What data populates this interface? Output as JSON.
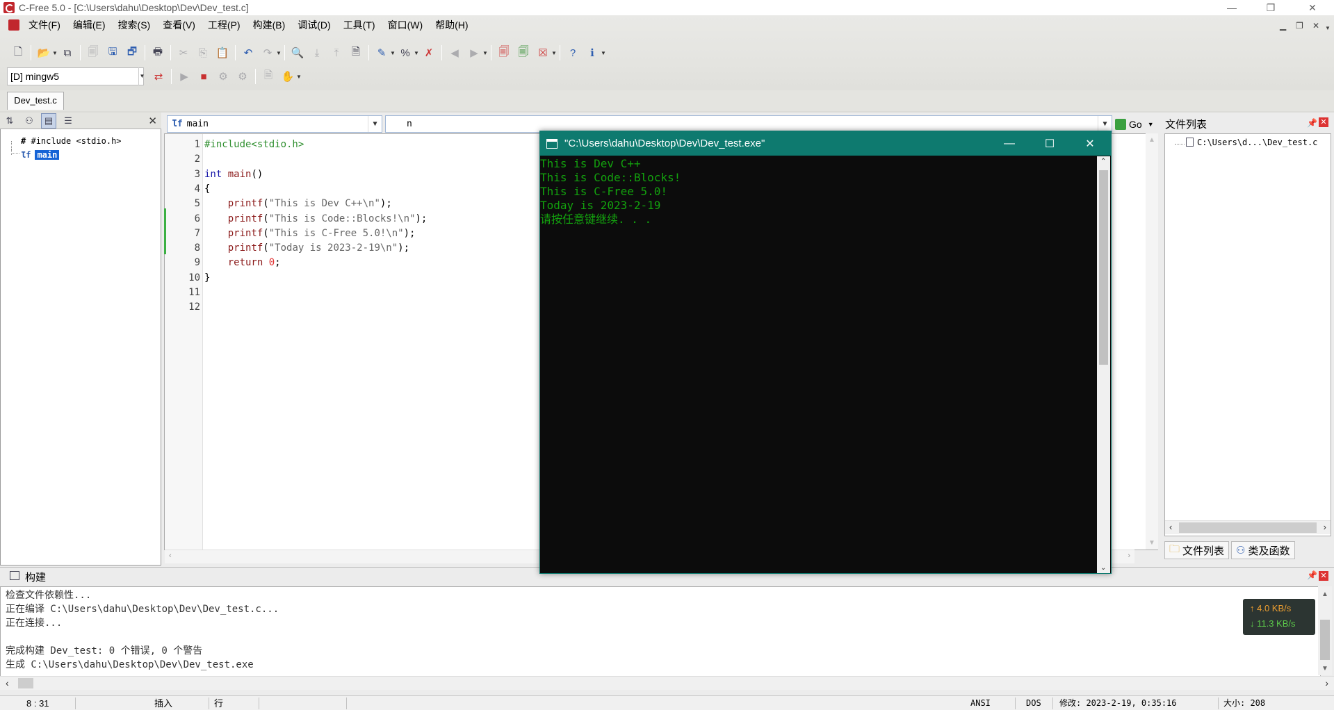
{
  "window": {
    "title": "C-Free 5.0 - [C:\\Users\\dahu\\Desktop\\Dev\\Dev_test.c]",
    "min": "—",
    "restore": "❐",
    "close": "✕"
  },
  "menu": [
    "文件(F)",
    "编辑(E)",
    "搜索(S)",
    "查看(V)",
    "工程(P)",
    "构建(B)",
    "调试(D)",
    "工具(T)",
    "窗口(W)",
    "帮助(H)"
  ],
  "compiler": {
    "value": "[D] mingw5"
  },
  "doc_tab": "Dev_test.c",
  "left_tree": {
    "include": "#include <stdio.h>",
    "func": "main"
  },
  "combo": {
    "scope": "main",
    "member": "n",
    "go": "Go"
  },
  "editor": {
    "line_numbers": [
      "1",
      "2",
      "3",
      "4",
      "5",
      "6",
      "7",
      "8",
      "9",
      "10",
      "11",
      "12"
    ],
    "lines": [
      [
        {
          "t": "#include<stdio.h>",
          "c": "pp"
        }
      ],
      [],
      [
        {
          "t": "int",
          "c": "kw"
        },
        {
          "t": " "
        },
        {
          "t": "main",
          "c": "fn"
        },
        {
          "t": "()"
        }
      ],
      [
        {
          "t": "{"
        }
      ],
      [
        {
          "t": "    "
        },
        {
          "t": "printf",
          "c": "fn"
        },
        {
          "t": "("
        },
        {
          "t": "\"This is Dev C++\\n\"",
          "c": "str"
        },
        {
          "t": ");"
        }
      ],
      [
        {
          "t": "    "
        },
        {
          "t": "printf",
          "c": "fn"
        },
        {
          "t": "("
        },
        {
          "t": "\"This is Code::Blocks!\\n\"",
          "c": "str"
        },
        {
          "t": ");"
        }
      ],
      [
        {
          "t": "    "
        },
        {
          "t": "printf",
          "c": "fn"
        },
        {
          "t": "("
        },
        {
          "t": "\"This is C-Free 5.0!\\n\"",
          "c": "str"
        },
        {
          "t": ");"
        }
      ],
      [
        {
          "t": "    "
        },
        {
          "t": "printf",
          "c": "fn"
        },
        {
          "t": "("
        },
        {
          "t": "\"Today is 2023-2-19\\n\"",
          "c": "str"
        },
        {
          "t": ");"
        }
      ],
      [
        {
          "t": "    "
        },
        {
          "t": "return",
          "c": "fn"
        },
        {
          "t": " "
        },
        {
          "t": "0",
          "c": "num"
        },
        {
          "t": ";"
        }
      ],
      [
        {
          "t": "}"
        }
      ],
      [],
      []
    ]
  },
  "right_panel": {
    "title": "文件列表",
    "item": "C:\\Users\\d...\\Dev_test.c",
    "tabs": [
      "文件列表",
      "类及函数"
    ]
  },
  "build": {
    "title": "构建",
    "lines": [
      "检查文件依赖性...",
      "正在编译 C:\\Users\\dahu\\Desktop\\Dev\\Dev_test.c...",
      "正在连接...",
      "",
      "完成构建 Dev_test: 0 个错误, 0 个警告",
      "生成 C:\\Users\\dahu\\Desktop\\Dev\\Dev_test.exe"
    ]
  },
  "net": {
    "up": "↑ 4.0 KB/s",
    "down": "↓ 11.3 KB/s",
    "up_color": "#f0a030",
    "down_color": "#5cc84a"
  },
  "console": {
    "title": "\"C:\\Users\\dahu\\Desktop\\Dev\\Dev_test.exe\"",
    "lines": [
      "This is Dev C++",
      "This is Code::Blocks!",
      "This is C-Free 5.0!",
      "Today is 2023-2-19",
      "请按任意键继续. . ."
    ]
  },
  "status": {
    "pos": "8 : 31",
    "mode": "插入",
    "unit": "行",
    "encoding": "ANSI",
    "eol": "DOS",
    "modified": "修改: 2023-2-19, 0:35:16",
    "size": "大小: 208"
  },
  "colors": {
    "console_title": "#0e7a6f",
    "console_text": "#13a10e",
    "accent_red": "#c1272d"
  }
}
